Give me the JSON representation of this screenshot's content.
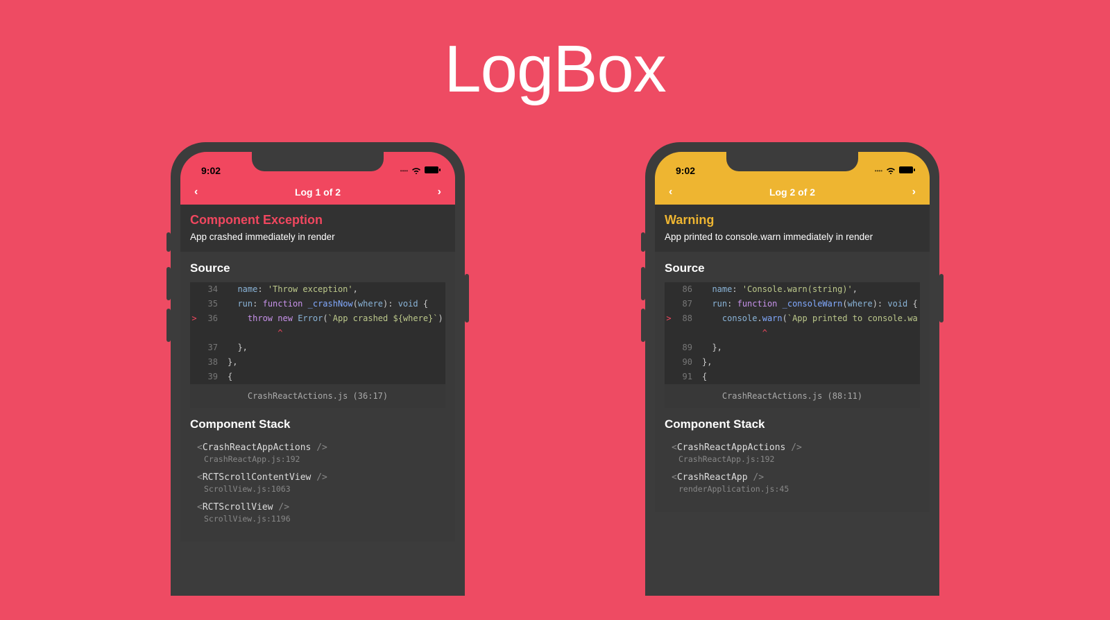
{
  "page_title": "LogBox",
  "phones": [
    {
      "variant": "error",
      "status_time": "9:02",
      "header_label": "Log 1 of 2",
      "title": "Component Exception",
      "subtitle": "App crashed immediately in render",
      "source_label": "Source",
      "code_lines": [
        {
          "no": "34",
          "marker": "",
          "segments": [
            [
              "  ",
              ""
            ],
            [
              "name",
              "tk-key"
            ],
            [
              ": ",
              ""
            ],
            [
              "'Throw exception'",
              "tk-str"
            ],
            [
              ",",
              ""
            ]
          ]
        },
        {
          "no": "35",
          "marker": "",
          "segments": [
            [
              "  ",
              ""
            ],
            [
              "run",
              "tk-key"
            ],
            [
              ": ",
              ""
            ],
            [
              "function",
              "tk-kw"
            ],
            [
              " ",
              ""
            ],
            [
              "_crashNow",
              "tk-fn"
            ],
            [
              "(",
              ""
            ],
            [
              "where",
              "tk-key"
            ],
            [
              "): ",
              ""
            ],
            [
              "void",
              "tk-type"
            ],
            [
              " {",
              ""
            ]
          ]
        },
        {
          "no": "36",
          "marker": ">",
          "segments": [
            [
              "    ",
              ""
            ],
            [
              "throw",
              "tk-kw"
            ],
            [
              " ",
              ""
            ],
            [
              "new",
              "tk-kw"
            ],
            [
              " ",
              ""
            ],
            [
              "Error",
              "tk-type"
            ],
            [
              "(",
              ""
            ],
            [
              "`App crashed ${where}`",
              "tk-str"
            ],
            [
              ");",
              ""
            ]
          ]
        },
        {
          "no": "",
          "marker": "",
          "caret": true,
          "segments": [
            [
              "          ^",
              "tk-err"
            ]
          ]
        },
        {
          "no": "37",
          "marker": "",
          "segments": [
            [
              "  },",
              ""
            ]
          ]
        },
        {
          "no": "38",
          "marker": "",
          "segments": [
            [
              "},",
              ""
            ]
          ]
        },
        {
          "no": "39",
          "marker": "",
          "segments": [
            [
              "{",
              ""
            ]
          ]
        }
      ],
      "file_footer": "CrashReactActions.js (36:17)",
      "stack_label": "Component Stack",
      "stack": [
        {
          "component": "CrashReactAppActions",
          "location": "CrashReactApp.js:192"
        },
        {
          "component": "RCTScrollContentView",
          "location": "ScrollView.js:1063"
        },
        {
          "component": "RCTScrollView",
          "location": "ScrollView.js:1196"
        }
      ]
    },
    {
      "variant": "warn",
      "status_time": "9:02",
      "header_label": "Log 2 of 2",
      "title": "Warning",
      "subtitle": "App printed to console.warn immediately in render",
      "source_label": "Source",
      "code_lines": [
        {
          "no": "86",
          "marker": "",
          "segments": [
            [
              "  ",
              ""
            ],
            [
              "name",
              "tk-key"
            ],
            [
              ": ",
              ""
            ],
            [
              "'Console.warn(string)'",
              "tk-str"
            ],
            [
              ",",
              ""
            ]
          ]
        },
        {
          "no": "87",
          "marker": "",
          "segments": [
            [
              "  ",
              ""
            ],
            [
              "run",
              "tk-key"
            ],
            [
              ": ",
              ""
            ],
            [
              "function",
              "tk-kw"
            ],
            [
              " ",
              ""
            ],
            [
              "_consoleWarn",
              "tk-fn"
            ],
            [
              "(",
              ""
            ],
            [
              "where",
              "tk-key"
            ],
            [
              "): ",
              ""
            ],
            [
              "void",
              "tk-type"
            ],
            [
              " {",
              ""
            ]
          ]
        },
        {
          "no": "88",
          "marker": ">",
          "segments": [
            [
              "    ",
              ""
            ],
            [
              "console",
              "tk-key"
            ],
            [
              ".",
              ""
            ],
            [
              "warn",
              "tk-fn"
            ],
            [
              "(",
              ""
            ],
            [
              "`App printed to console.warn",
              "tk-str"
            ]
          ]
        },
        {
          "no": "",
          "marker": "",
          "caret": true,
          "segments": [
            [
              "            ^",
              "tk-err"
            ]
          ]
        },
        {
          "no": "89",
          "marker": "",
          "segments": [
            [
              "  },",
              ""
            ]
          ]
        },
        {
          "no": "90",
          "marker": "",
          "segments": [
            [
              "},",
              ""
            ]
          ]
        },
        {
          "no": "91",
          "marker": "",
          "segments": [
            [
              "{",
              ""
            ]
          ]
        }
      ],
      "file_footer": "CrashReactActions.js (88:11)",
      "stack_label": "Component Stack",
      "stack": [
        {
          "component": "CrashReactAppActions",
          "location": "CrashReactApp.js:192"
        },
        {
          "component": "CrashReactApp",
          "location": "renderApplication.js:45"
        }
      ]
    }
  ]
}
